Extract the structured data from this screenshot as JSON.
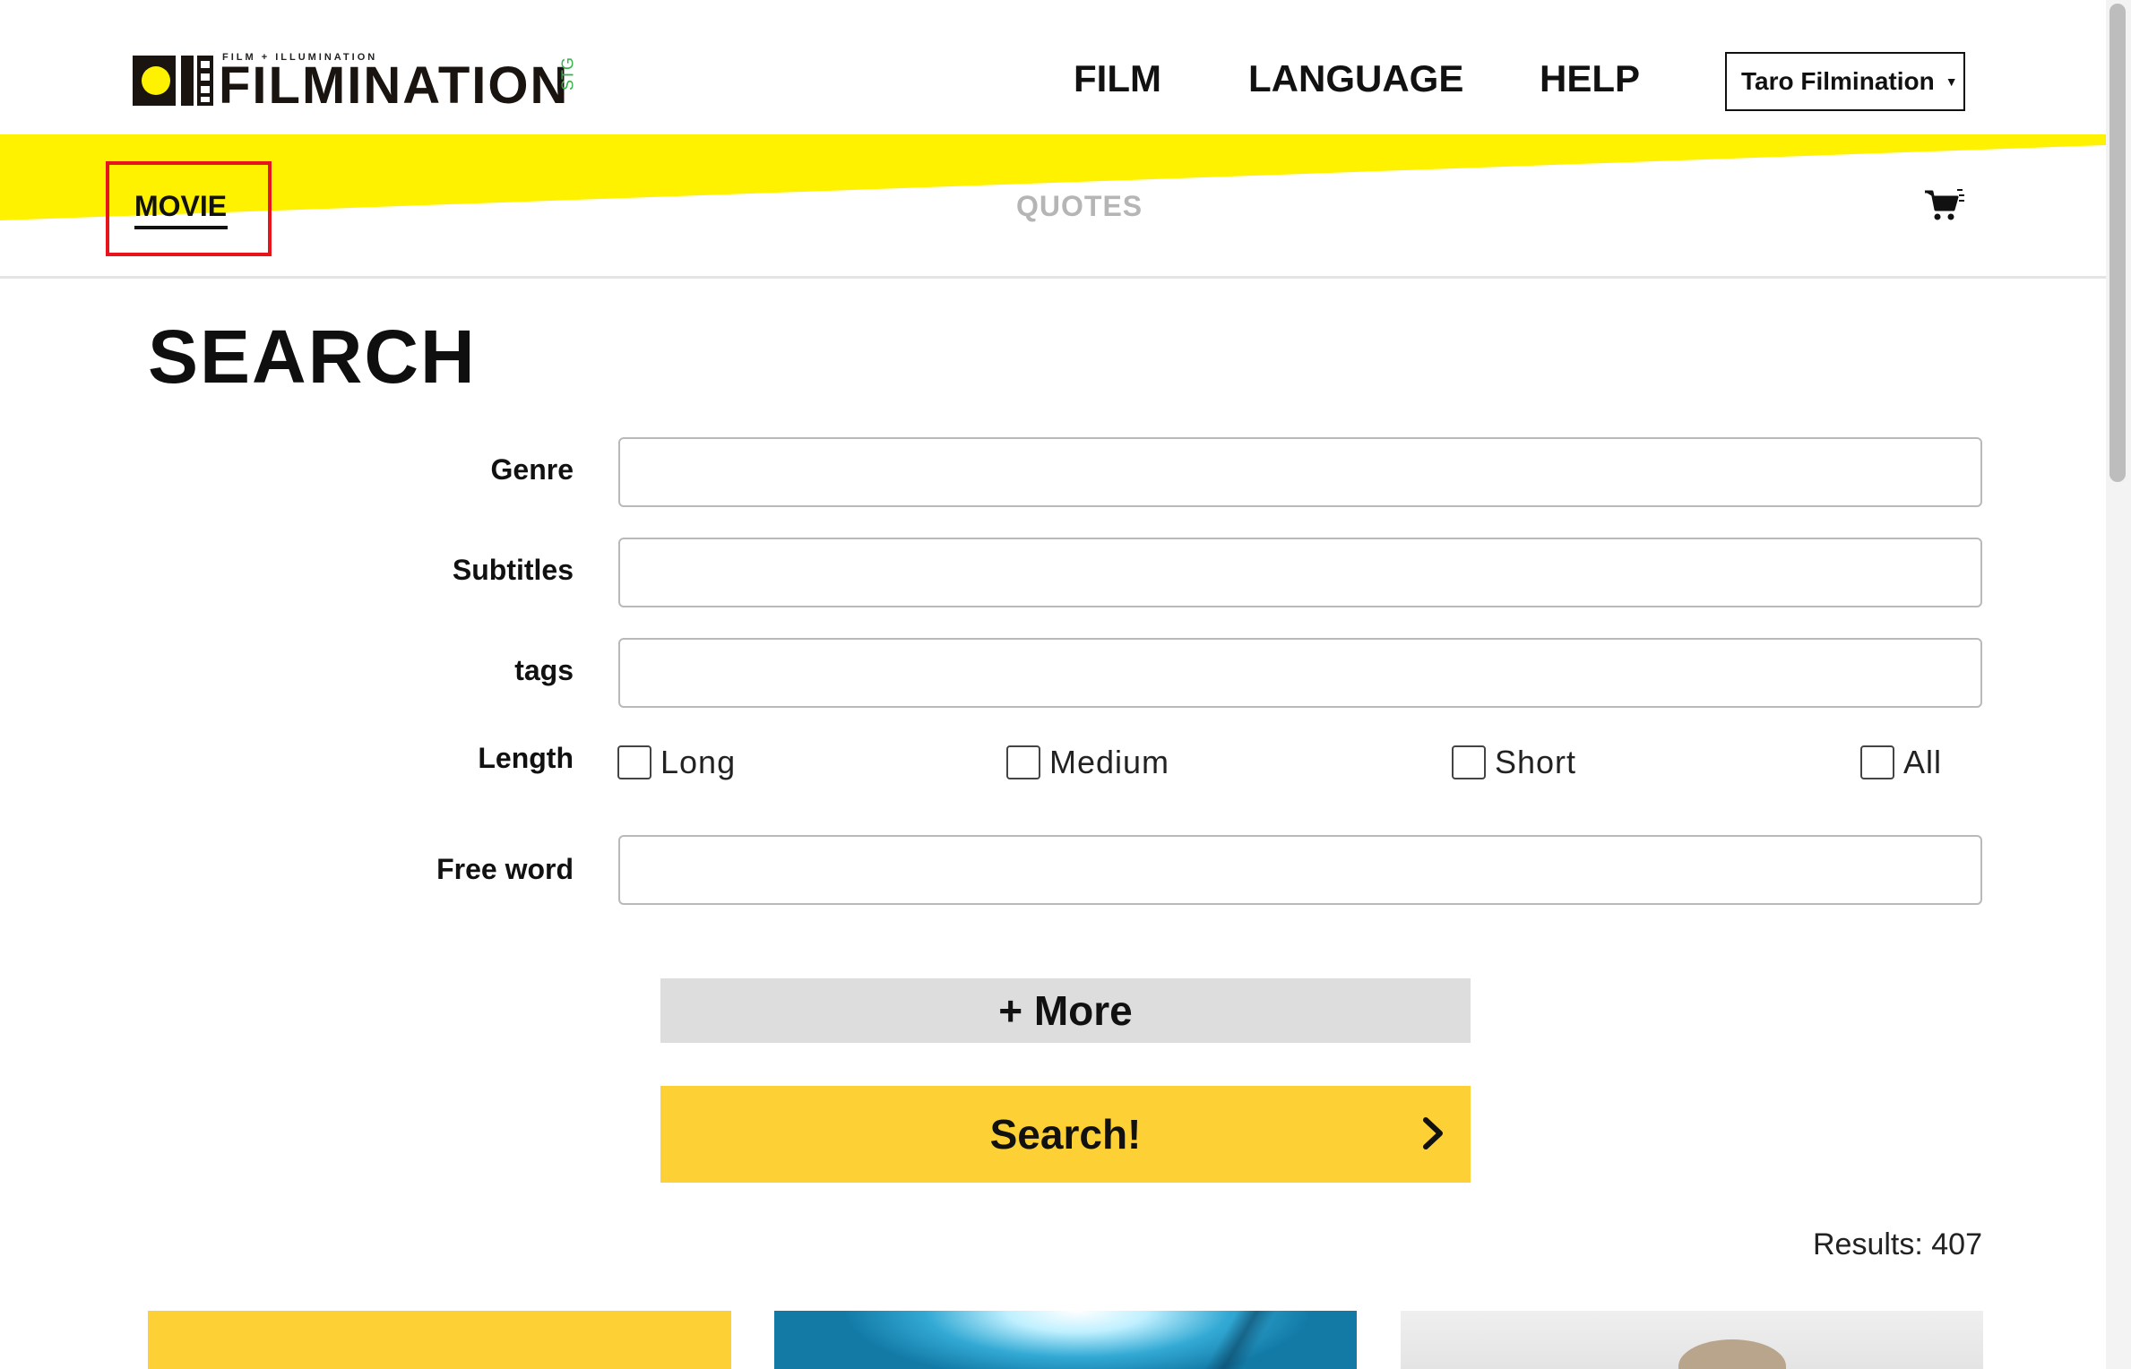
{
  "brand": {
    "tagline": "FILM + ILLUMINATION",
    "name": "FILMINATION",
    "env_badge": "STG",
    "accent_yellow": "#fff200",
    "env_color": "#35b34a"
  },
  "nav": {
    "film": "FILM",
    "language": "LANGUAGE",
    "help": "HELP",
    "user": "Taro Filmination"
  },
  "tabs": {
    "movie": "MOVIE",
    "quotes": "QUOTES",
    "cart_icon": "cart-icon"
  },
  "search": {
    "title": "SEARCH",
    "genre": {
      "label": "Genre",
      "value": ""
    },
    "subtitles": {
      "label": "Subtitles",
      "value": ""
    },
    "tags": {
      "label": "tags",
      "value": ""
    },
    "length": {
      "label": "Length",
      "options": [
        {
          "label": "Long",
          "checked": false
        },
        {
          "label": "Medium",
          "checked": false
        },
        {
          "label": "Short",
          "checked": false
        },
        {
          "label": "All",
          "checked": false
        }
      ]
    },
    "free_word": {
      "label": "Free word",
      "value": ""
    },
    "more_label": "+ More",
    "search_label": "Search!",
    "button_yellow": "#fdd136",
    "highlight_color": "#e8141c"
  },
  "results": {
    "text": "Results: 407"
  }
}
